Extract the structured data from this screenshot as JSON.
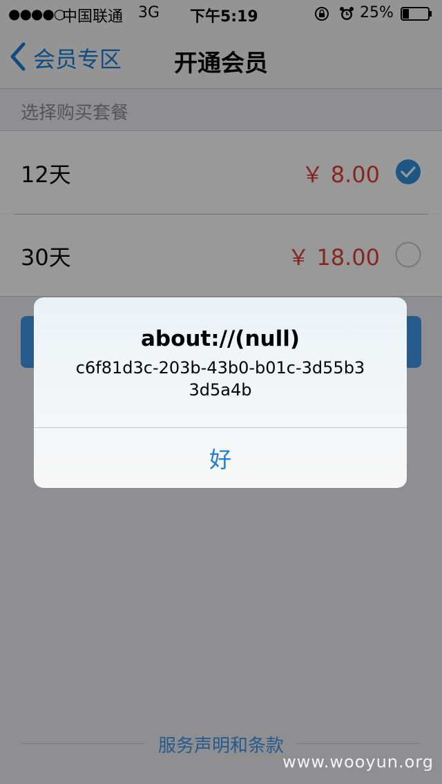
{
  "status_bar": {
    "signal": "●●●●○",
    "carrier": "中国联通",
    "network": "3G",
    "time": "下午5:19",
    "battery": "25%",
    "battery_level": 0.25,
    "icons": [
      "signal-icon",
      "orientation-lock-icon",
      "alarm-icon",
      "battery-icon"
    ]
  },
  "nav": {
    "back_label": "会员专区",
    "title": "开通会员"
  },
  "section": {
    "header": "选择购买套餐"
  },
  "plans": [
    {
      "name": "12天",
      "price": "￥ 8.00",
      "selected": true
    },
    {
      "name": "30天",
      "price": "￥ 18.00",
      "selected": false
    }
  ],
  "footer": {
    "terms_label": "服务声明和条款"
  },
  "alert": {
    "title": "about://(null)",
    "message": "c6f81d3c-203b-43b0-b01c-3d55b33d5a4b",
    "button_label": "好"
  },
  "watermark": "www.wooyun.org",
  "colors": {
    "accent": "#1a7ed6",
    "price": "#e0403a",
    "button": "#3e96e6"
  }
}
